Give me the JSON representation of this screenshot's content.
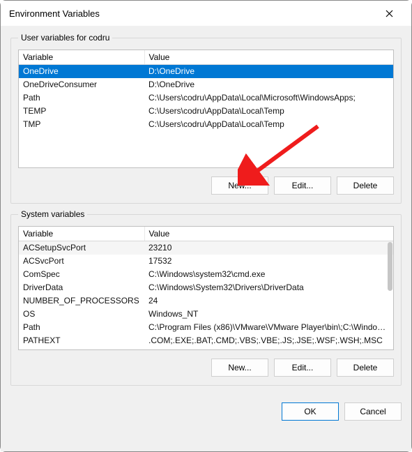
{
  "window": {
    "title": "Environment Variables"
  },
  "userSection": {
    "legend": "User variables for codru",
    "headers": {
      "variable": "Variable",
      "value": "Value"
    },
    "rows": [
      {
        "variable": "OneDrive",
        "value": "D:\\OneDrive",
        "selected": true
      },
      {
        "variable": "OneDriveConsumer",
        "value": "D:\\OneDrive"
      },
      {
        "variable": "Path",
        "value": "C:\\Users\\codru\\AppData\\Local\\Microsoft\\WindowsApps;"
      },
      {
        "variable": "TEMP",
        "value": "C:\\Users\\codru\\AppData\\Local\\Temp"
      },
      {
        "variable": "TMP",
        "value": "C:\\Users\\codru\\AppData\\Local\\Temp"
      }
    ],
    "buttons": {
      "new": "New...",
      "edit": "Edit...",
      "delete": "Delete"
    }
  },
  "systemSection": {
    "legend": "System variables",
    "headers": {
      "variable": "Variable",
      "value": "Value"
    },
    "rows": [
      {
        "variable": "ACSetupSvcPort",
        "value": "23210",
        "alt": true
      },
      {
        "variable": "ACSvcPort",
        "value": "17532"
      },
      {
        "variable": "ComSpec",
        "value": "C:\\Windows\\system32\\cmd.exe"
      },
      {
        "variable": "DriverData",
        "value": "C:\\Windows\\System32\\Drivers\\DriverData"
      },
      {
        "variable": "NUMBER_OF_PROCESSORS",
        "value": "24"
      },
      {
        "variable": "OS",
        "value": "Windows_NT"
      },
      {
        "variable": "Path",
        "value": "C:\\Program Files (x86)\\VMware\\VMware Player\\bin\\;C:\\Windows\\..."
      },
      {
        "variable": "PATHEXT",
        "value": ".COM;.EXE;.BAT;.CMD;.VBS;.VBE;.JS;.JSE;.WSF;.WSH;.MSC"
      }
    ],
    "buttons": {
      "new": "New...",
      "edit": "Edit...",
      "delete": "Delete"
    }
  },
  "footer": {
    "ok": "OK",
    "cancel": "Cancel"
  }
}
